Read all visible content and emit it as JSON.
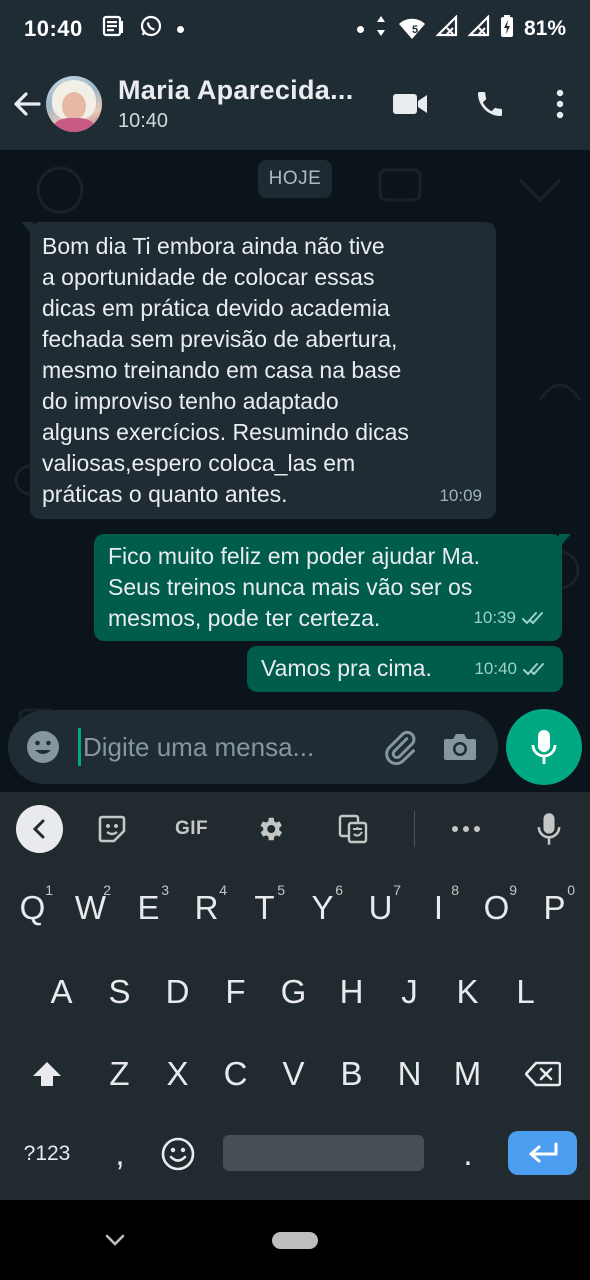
{
  "status_bar": {
    "time": "10:40",
    "battery_text": "81%",
    "network_badge": "5"
  },
  "header": {
    "contact_name": "Maria Aparecida...",
    "subtitle": "10:40"
  },
  "chat": {
    "date_label": "HOJE",
    "messages": [
      {
        "direction": "incoming",
        "text": "Bom dia Ti embora ainda  não tive\na oportunidade  de colocar essas\ndicas em prática devido academia\nfechada sem previsão  de abertura,\nmesmo treinando em casa na base\ndo improviso  tenho adaptado\nalguns exercícios. Resumindo dicas\nvaliosas,espero coloca_las  em\npráticas  o quanto antes.",
        "time": "10:09"
      },
      {
        "direction": "outgoing",
        "text": "Fico muito feliz em poder ajudar Ma.\nSeus treinos nunca mais vão ser os\nmesmos, pode ter certeza.",
        "time": "10:39",
        "status": "read"
      },
      {
        "direction": "outgoing",
        "text": "Vamos pra cima.",
        "time": "10:40",
        "status": "read"
      }
    ]
  },
  "composer": {
    "placeholder": "Digite uma mensa..."
  },
  "keyboard": {
    "toolbar": {
      "gif_label": "GIF"
    },
    "row1": [
      {
        "label": "Q",
        "hint": "1"
      },
      {
        "label": "W",
        "hint": "2"
      },
      {
        "label": "E",
        "hint": "3"
      },
      {
        "label": "R",
        "hint": "4"
      },
      {
        "label": "T",
        "hint": "5"
      },
      {
        "label": "Y",
        "hint": "6"
      },
      {
        "label": "U",
        "hint": "7"
      },
      {
        "label": "I",
        "hint": "8"
      },
      {
        "label": "O",
        "hint": "9"
      },
      {
        "label": "P",
        "hint": "0"
      }
    ],
    "row2": [
      "A",
      "S",
      "D",
      "F",
      "G",
      "H",
      "J",
      "K",
      "L"
    ],
    "row3": [
      "Z",
      "X",
      "C",
      "V",
      "B",
      "N",
      "M"
    ],
    "symbols_label": "?123",
    "comma_label": ",",
    "period_label": "."
  },
  "colors": {
    "header_bg": "#1f2c34",
    "chat_bg": "#0b141a",
    "incoming_bubble": "#1f2c34",
    "outgoing_bubble": "#005c4b",
    "accent": "#00a884",
    "keyboard_bg": "#212a2f",
    "enter_key": "#4b9df0",
    "read_ticks": "#9bd3c6"
  },
  "icons": {
    "status_left": [
      "news-icon",
      "whatsapp-icon"
    ],
    "status_right": [
      "alarm-dot",
      "data-arrows-icon",
      "wifi-icon",
      "signal-icon",
      "signal-icon",
      "battery-icon"
    ],
    "header": [
      "back-arrow-icon",
      "video-call-icon",
      "phone-call-icon",
      "more-vert-icon"
    ],
    "composer": [
      "emoji-icon",
      "attach-icon",
      "camera-icon",
      "mic-icon"
    ],
    "keyboard_toolbar": [
      "chevron-left-icon",
      "sticker-icon",
      "gif-icon",
      "settings-icon",
      "translate-icon",
      "more-horiz-icon",
      "voice-input-icon"
    ]
  }
}
